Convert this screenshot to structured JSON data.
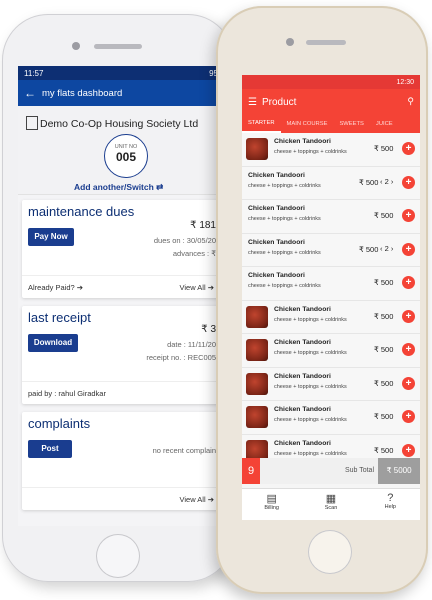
{
  "left_app": {
    "status": {
      "time": "11:57",
      "battery": "95"
    },
    "appbar": {
      "back_icon": "arrow-left-icon",
      "title": "my flats dashboard"
    },
    "society": {
      "name": "Demo Co-Op Housing Society Ltd",
      "unit_label": "UNIT NO",
      "unit_no": "005",
      "switch_label": "Add another/Switch ⇄"
    },
    "maintenance": {
      "title": "maintenance dues",
      "button": "Pay Now",
      "amount": "₹ 181",
      "dues_on": "dues on : 30/05/20",
      "advances": "advances : ₹",
      "already_paid": "Already Paid? ➔",
      "view_all": "View All ➔"
    },
    "receipt": {
      "title": "last receipt",
      "button": "Download",
      "amount": "₹ 3",
      "date": "date : 11/11/20",
      "receipt_no": "receipt no. : REC005",
      "paid_by": "paid by : rahul Giradkar",
      "view_all": "View All ➔"
    },
    "complaints": {
      "title": "complaints",
      "button": "Post",
      "note": "no recent complain",
      "view_all": "View All ➔"
    }
  },
  "right_app": {
    "status": {
      "time": "12:30"
    },
    "appbar": {
      "title": "Product",
      "menu_icon": "hamburger-menu-icon",
      "search_icon": "search-icon"
    },
    "tabs": [
      "STARTER",
      "MAIN COURSE",
      "SWEETS",
      "JUICE"
    ],
    "products": [
      {
        "name": "Chicken Tandoori",
        "desc": "cheese + toppings + coldrinks",
        "price": "₹ 500",
        "qty": null,
        "thumb": true
      },
      {
        "name": "Chicken Tandoori",
        "desc": "cheese + toppings + coldrinks",
        "price": "₹ 500",
        "qty": "2",
        "thumb": false
      },
      {
        "name": "Chicken Tandoori",
        "desc": "cheese + toppings + coldrinks",
        "price": "₹ 500",
        "qty": null,
        "thumb": false
      },
      {
        "name": "Chicken Tandoori",
        "desc": "cheese + toppings + coldrinks",
        "price": "₹ 500",
        "qty": "2",
        "thumb": false
      },
      {
        "name": "Chicken Tandoori",
        "desc": "cheese + toppings + coldrinks",
        "price": "₹ 500",
        "qty": null,
        "thumb": false
      },
      {
        "name": "Chicken Tandoori",
        "desc": "cheese + toppings + coldrinks",
        "price": "₹ 500",
        "qty": null,
        "thumb": true
      },
      {
        "name": "Chicken Tandoori",
        "desc": "cheese + toppings + coldrinks",
        "price": "₹ 500",
        "qty": null,
        "thumb": true
      },
      {
        "name": "Chicken Tandoori",
        "desc": "cheese + toppings + coldrinks",
        "price": "₹ 500",
        "qty": null,
        "thumb": true
      },
      {
        "name": "Chicken Tandoori",
        "desc": "cheese + toppings + coldrinks",
        "price": "₹ 500",
        "qty": null,
        "thumb": true
      },
      {
        "name": "Chicken Tandoori",
        "desc": "cheese + toppings + coldrinks",
        "price": "₹ 500",
        "qty": null,
        "thumb": true
      }
    ],
    "cart": {
      "count": "9",
      "subtotal_label": "Sub Total",
      "total": "₹ 5000"
    },
    "bottom_nav": [
      {
        "label": "Billing",
        "icon": "receipt-icon"
      },
      {
        "label": "Scan",
        "icon": "qr-code-icon"
      },
      {
        "label": "Help",
        "icon": "help-icon"
      }
    ],
    "colors": {
      "primary": "#f44336",
      "dark": "#e53935"
    }
  }
}
